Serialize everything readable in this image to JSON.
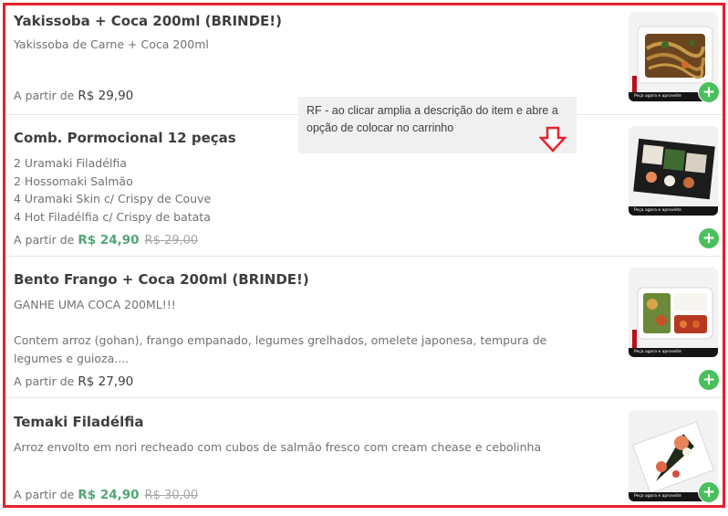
{
  "items": [
    {
      "title": "Yakissoba + Coca 200ml (BRINDE!)",
      "description": "Yakissoba de Carne + Coca 200ml",
      "price_prefix": "A partir de",
      "price": "R$ 29,90",
      "image_caption": "Peça agora e aproveite",
      "add_label": "+"
    },
    {
      "title": "Comb. Pormocional 12 peças",
      "description_lines": [
        "2 Uramaki Filadélfia",
        "2 Hossomaki Salmão",
        "4 Uramaki Skin c/ Crispy de Couve",
        "4 Hot Filadélfia c/ Crispy de batata"
      ],
      "price_prefix": "A partir de",
      "price": "R$ 24,90",
      "old_price": "R$ 29,00",
      "image_caption": "Peça agora e aproveite",
      "add_label": "+"
    },
    {
      "title": "Bento Frango + Coca 200ml (BRINDE!)",
      "description_line1": "GANHE UMA COCA 200ML!!!",
      "description_line2": "Contem arroz (gohan), frango empanado, legumes grelhados, omelete japonesa, tempura de legumes e guioza....",
      "price_prefix": "A partir de",
      "price": "R$ 27,90",
      "image_caption": "Peça agora e aproveite",
      "add_label": "+"
    },
    {
      "title": "Temaki Filadélfia",
      "description": "Arroz envolto em nori recheado com cubos de salmão fresco com cream chease e cebolinha",
      "price_prefix": "A partir de",
      "price": "R$ 24,90",
      "old_price": "R$ 30,00",
      "image_caption": "Peça agora e aproveite",
      "add_label": "+"
    }
  ],
  "annotation": {
    "text": "RF - ao clicar amplia a descrição do item e abre a opção de colocar no carrinho",
    "arrow": "down-arrow-icon"
  },
  "colors": {
    "frame": "#e8212c",
    "promo_price": "#50a773",
    "add_button": "#4ac05c"
  }
}
